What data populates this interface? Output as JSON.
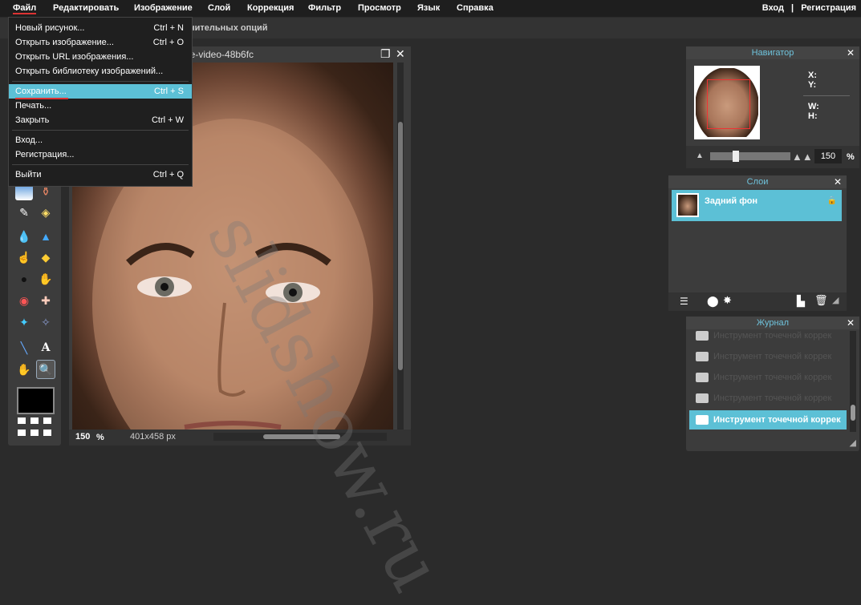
{
  "menu": {
    "items": [
      "Файл",
      "Редактировать",
      "Изображение",
      "Слой",
      "Коррекция",
      "Фильтр",
      "Просмотр",
      "Язык",
      "Справка"
    ],
    "login": "Вход",
    "divider": "|",
    "register": "Регистрация"
  },
  "options_bar": {
    "text": "нительных опций"
  },
  "file_menu": {
    "items": [
      {
        "label": "Новый рисунок...",
        "shortcut": "Ctrl + N"
      },
      {
        "label": "Открыть изображение...",
        "shortcut": "Ctrl + O"
      },
      {
        "label": "Открыть URL изображения...",
        "shortcut": ""
      },
      {
        "label": "Открыть библиотеку изображений...",
        "shortcut": ""
      },
      {
        "label": "Сохранить...",
        "shortcut": "Ctrl + S"
      },
      {
        "label": "Печать...",
        "shortcut": ""
      },
      {
        "label": "Закрыть",
        "shortcut": "Ctrl + W"
      },
      {
        "label": "Вход...",
        "shortcut": ""
      },
      {
        "label": "Регистрация...",
        "shortcut": ""
      },
      {
        "label": "Выйти",
        "shortcut": "Ctrl + Q"
      }
    ]
  },
  "document": {
    "title": "ake-video-48b6fc",
    "zoom": "150",
    "zoom_unit": "%",
    "size": "401x458 px"
  },
  "navigator": {
    "title": "Навигатор",
    "x_label": "X:",
    "y_label": "Y:",
    "w_label": "W:",
    "h_label": "H:",
    "zoom": "150",
    "zoom_unit": "%"
  },
  "layers": {
    "title": "Слои",
    "items": [
      {
        "name": "Задний фон"
      }
    ]
  },
  "history": {
    "title": "Журнал",
    "items": [
      "Инструмент точечной коррек",
      "Инструмент точечной коррек",
      "Инструмент точечной коррек",
      "Инструмент точечной коррек",
      "Инструмент точечной коррек"
    ]
  },
  "watermark": "slidshow.ru",
  "colors": {
    "accent": "#5cc0d6",
    "menu_bg": "#1e1e1e",
    "panel_bg": "#3c3c3c"
  }
}
